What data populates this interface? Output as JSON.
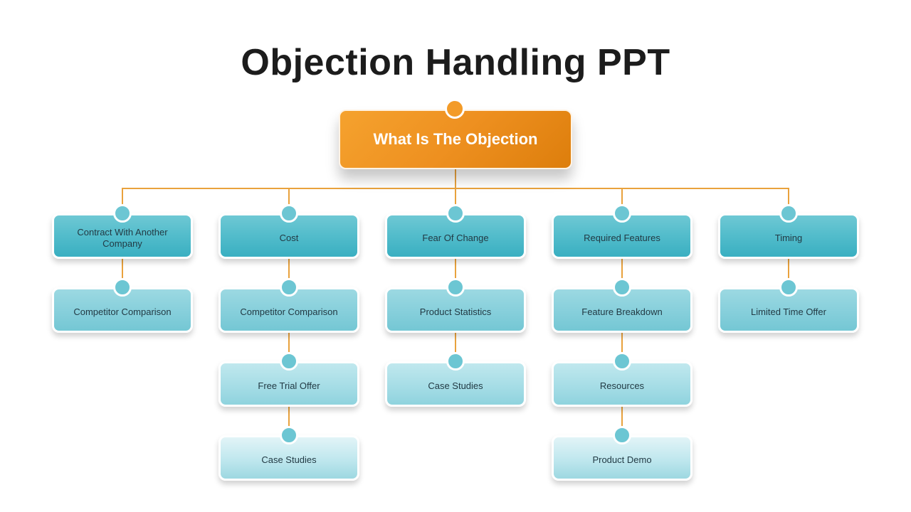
{
  "title": "Objection Handling PPT",
  "colors": {
    "root": "#ee9020",
    "connector": "#e9a23d",
    "level1": "#52bccb",
    "level2": "#86cfdb",
    "text_dark": "#223a44"
  },
  "root": {
    "label": "What Is The Objection"
  },
  "branches": [
    {
      "label": "Contract With Another Company",
      "children": [
        "Competitor Comparison"
      ]
    },
    {
      "label": "Cost",
      "children": [
        "Competitor Comparison",
        "Free Trial Offer",
        "Case Studies"
      ]
    },
    {
      "label": "Fear Of Change",
      "children": [
        "Product Statistics",
        "Case Studies"
      ]
    },
    {
      "label": "Required Features",
      "children": [
        "Feature Breakdown",
        "Resources",
        "Product Demo"
      ]
    },
    {
      "label": "Timing",
      "children": [
        "Limited Time Offer"
      ]
    }
  ]
}
